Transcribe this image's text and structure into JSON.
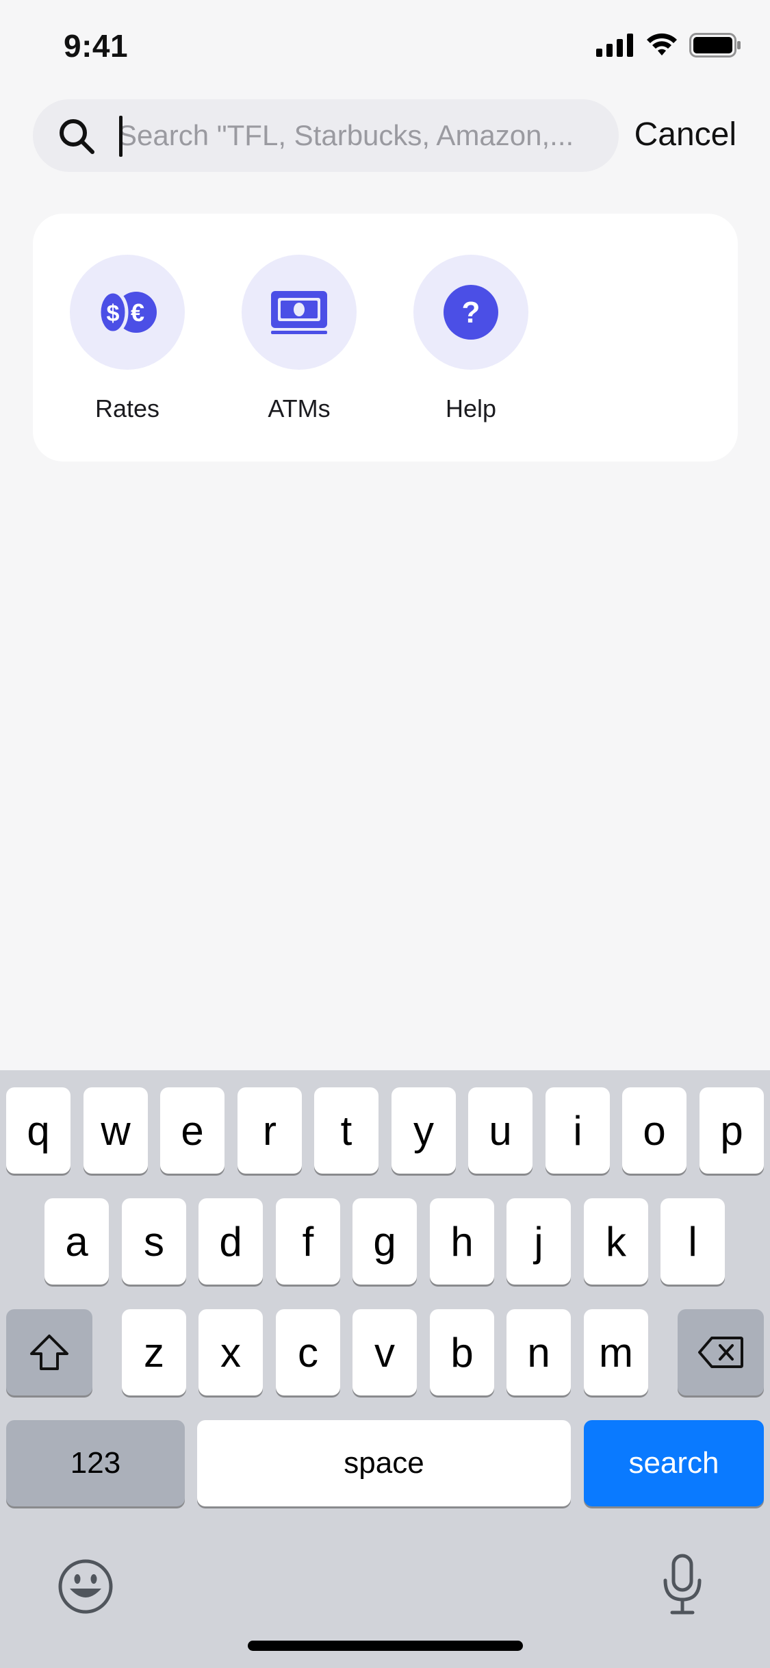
{
  "status_bar": {
    "time": "9:41"
  },
  "search": {
    "placeholder": "Search \"TFL, Starbucks, Amazon,...",
    "value": "",
    "cancel_label": "Cancel"
  },
  "quick_actions": [
    {
      "label": "Rates",
      "icon": "currency-exchange-icon"
    },
    {
      "label": "ATMs",
      "icon": "cash-icon"
    },
    {
      "label": "Help",
      "icon": "question-icon"
    }
  ],
  "keyboard": {
    "row1": [
      "q",
      "w",
      "e",
      "r",
      "t",
      "y",
      "u",
      "i",
      "o",
      "p"
    ],
    "row2": [
      "a",
      "s",
      "d",
      "f",
      "g",
      "h",
      "j",
      "k",
      "l"
    ],
    "row3": [
      "z",
      "x",
      "c",
      "v",
      "b",
      "n",
      "m"
    ],
    "numbers_label": "123",
    "space_label": "space",
    "search_label": "search"
  },
  "colors": {
    "accent": "#4b4fe6",
    "icon_bg": "#ebebfb",
    "keyboard_bg": "#d1d3d9",
    "search_key": "#0a7aff"
  }
}
